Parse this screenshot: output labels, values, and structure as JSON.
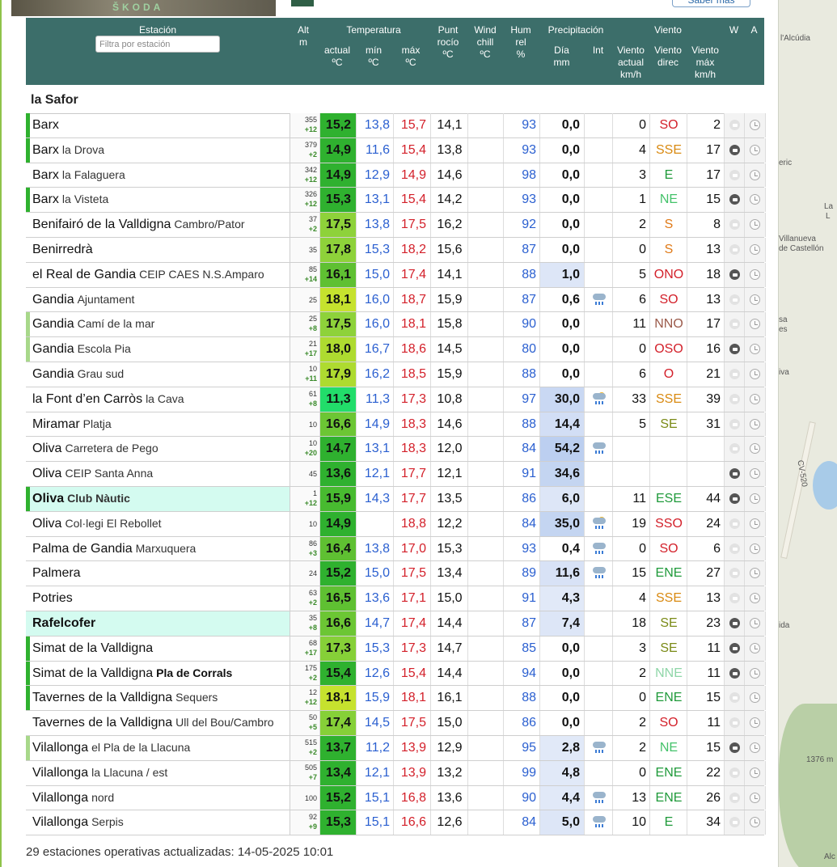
{
  "ad": {
    "brand": "ŠKODA",
    "button_label": "Saber más"
  },
  "header": {
    "station": "Estación",
    "filter_placeholder": "Filtra por estación",
    "alt": "Alt",
    "alt_unit": "m",
    "temperatura": "Temperatura",
    "actual": "actual",
    "actual_unit": "ºC",
    "min": "mín",
    "min_unit": "ºC",
    "max": "máx",
    "max_unit": "ºC",
    "dew_1": "Punt",
    "dew_2": "rocío",
    "dew_unit": "ºC",
    "wc_1": "Wind",
    "wc_2": "chill",
    "wc_unit": "ºC",
    "hum_1": "Hum",
    "hum_2": "rel",
    "hum_unit": "%",
    "precip": "Precipitación",
    "dia": "Día",
    "dia_unit": "mm",
    "int": "Int",
    "viento": "Viento",
    "wact_1": "Viento",
    "wact_2": "actual",
    "wact_unit": "km/h",
    "wdir_1": "Viento",
    "wdir_2": "direc",
    "wmax_1": "Viento",
    "wmax_2": "máx",
    "wmax_unit": "km/h",
    "w": "W",
    "a": "A"
  },
  "region": "la Safor",
  "stations": [
    {
      "name": "Barx",
      "sub": "",
      "alt": "355",
      "d": "+12",
      "t": "15,2",
      "tc": "#2fb12f",
      "min": "13,8",
      "max": "15,7",
      "dew": "14,1",
      "hum": "93",
      "p": "0,0",
      "pc": "",
      "int": "",
      "wa": "0",
      "wd": "SO",
      "wdc": "#d3202a",
      "wm": "2",
      "bar": "#2fb12f",
      "hl": false,
      "cam": "off"
    },
    {
      "name": "Barx",
      "sub": "la Drova",
      "alt": "379",
      "d": "+2",
      "t": "14,9",
      "tc": "#2fb12f",
      "min": "11,6",
      "max": "15,4",
      "dew": "13,8",
      "hum": "93",
      "p": "0,0",
      "pc": "",
      "int": "",
      "wa": "4",
      "wd": "SSE",
      "wdc": "#d98a12",
      "wm": "17",
      "bar": "#2fb12f",
      "hl": false,
      "cam": "on"
    },
    {
      "name": "Barx",
      "sub": "la Falaguera",
      "alt": "342",
      "d": "+12",
      "t": "14,9",
      "tc": "#2fb12f",
      "min": "12,9",
      "max": "14,9",
      "dew": "14,6",
      "hum": "98",
      "p": "0,0",
      "pc": "",
      "int": "",
      "wa": "3",
      "wd": "E",
      "wdc": "#1f9a3a",
      "wm": "17",
      "bar": "",
      "hl": false,
      "cam": "off"
    },
    {
      "name": "Barx",
      "sub": "la Visteta",
      "alt": "326",
      "d": "+12",
      "t": "15,3",
      "tc": "#2fb12f",
      "min": "13,1",
      "max": "15,4",
      "dew": "14,2",
      "hum": "93",
      "p": "0,0",
      "pc": "",
      "int": "",
      "wa": "1",
      "wd": "NE",
      "wdc": "#44c26a",
      "wm": "15",
      "bar": "#2fb12f",
      "hl": false,
      "cam": "on"
    },
    {
      "name": "Benifairó de la Valldigna",
      "sub": "Cambro/Pator",
      "alt": "37",
      "d": "+2",
      "t": "17,5",
      "tc": "#8ed23a",
      "min": "13,8",
      "max": "17,5",
      "dew": "16,2",
      "hum": "92",
      "p": "0,0",
      "pc": "",
      "int": "",
      "wa": "2",
      "wd": "S",
      "wdc": "#e07a18",
      "wm": "8",
      "bar": "",
      "hl": false,
      "cam": "off"
    },
    {
      "name": "Benirredrà",
      "sub": "",
      "alt": "35",
      "d": "",
      "t": "17,8",
      "tc": "#8ed23a",
      "min": "15,3",
      "max": "18,2",
      "dew": "15,6",
      "hum": "87",
      "p": "0,0",
      "pc": "",
      "int": "",
      "wa": "0",
      "wd": "S",
      "wdc": "#e07a18",
      "wm": "13",
      "bar": "",
      "hl": false,
      "cam": "off"
    },
    {
      "name": "el Real de Gandia",
      "sub": "CEIP CAES N.S.Amparo",
      "alt": "85",
      "d": "+14",
      "t": "16,1",
      "tc": "#5fc032",
      "min": "15,0",
      "max": "17,4",
      "dew": "14,1",
      "hum": "88",
      "p": "1,0",
      "pc": "#dde6f7",
      "int": "",
      "wa": "5",
      "wd": "ONO",
      "wdc": "#d3202a",
      "wm": "18",
      "bar": "",
      "hl": false,
      "cam": "on"
    },
    {
      "name": "Gandia",
      "sub": "Ajuntament",
      "alt": "25",
      "d": "",
      "t": "18,1",
      "tc": "#c6e22e",
      "min": "16,0",
      "max": "18,7",
      "dew": "15,9",
      "hum": "87",
      "p": "0,6",
      "pc": "",
      "int": "rain",
      "wa": "6",
      "wd": "SO",
      "wdc": "#d3202a",
      "wm": "13",
      "bar": "",
      "hl": false,
      "cam": "off"
    },
    {
      "name": "Gandia",
      "sub": "Camí de la mar",
      "alt": "25",
      "d": "+8",
      "t": "17,5",
      "tc": "#8ed23a",
      "min": "16,0",
      "max": "18,1",
      "dew": "15,8",
      "hum": "90",
      "p": "0,0",
      "pc": "",
      "int": "",
      "wa": "11",
      "wd": "NNO",
      "wdc": "#9b5a4a",
      "wm": "17",
      "bar": "#a8d88a",
      "hl": false,
      "cam": "off"
    },
    {
      "name": "Gandia",
      "sub": "Escola Pia",
      "alt": "21",
      "d": "+17",
      "t": "18,0",
      "tc": "#aedb30",
      "min": "16,7",
      "max": "18,6",
      "dew": "14,5",
      "hum": "80",
      "p": "0,0",
      "pc": "",
      "int": "",
      "wa": "0",
      "wd": "OSO",
      "wdc": "#d3202a",
      "wm": "16",
      "bar": "#a8d88a",
      "hl": false,
      "cam": "on"
    },
    {
      "name": "Gandia",
      "sub": "Grau sud",
      "alt": "10",
      "d": "+11",
      "t": "17,9",
      "tc": "#aedb30",
      "min": "16,2",
      "max": "18,5",
      "dew": "15,9",
      "hum": "88",
      "p": "0,0",
      "pc": "",
      "int": "",
      "wa": "6",
      "wd": "O",
      "wdc": "#d3202a",
      "wm": "21",
      "bar": "",
      "hl": false,
      "cam": "off"
    },
    {
      "name": "la Font d’en Carròs",
      "sub": "la Cava",
      "alt": "61",
      "d": "+8",
      "t": "11,3",
      "tc": "#22dd6a",
      "min": "11,3",
      "max": "17,3",
      "dew": "10,8",
      "hum": "97",
      "p": "30,0",
      "pc": "#c9d8f3",
      "int": "storm",
      "wa": "33",
      "wd": "SSE",
      "wdc": "#d98a12",
      "wm": "39",
      "bar": "",
      "hl": false,
      "cam": "off"
    },
    {
      "name": "Miramar",
      "sub": "Platja",
      "alt": "10",
      "d": "",
      "t": "16,6",
      "tc": "#6cc634",
      "min": "14,9",
      "max": "18,3",
      "dew": "14,6",
      "hum": "88",
      "p": "14,4",
      "pc": "#d2def5",
      "int": "",
      "wa": "5",
      "wd": "SE",
      "wdc": "#7a8a16",
      "wm": "31",
      "bar": "",
      "hl": false,
      "cam": "off"
    },
    {
      "name": "Oliva",
      "sub": "Carretera de Pego",
      "alt": "10",
      "d": "+20",
      "t": "14,7",
      "tc": "#2fb12f",
      "min": "13,1",
      "max": "18,3",
      "dew": "12,0",
      "hum": "84",
      "p": "54,2",
      "pc": "#bccff0",
      "int": "rain",
      "wa": "",
      "wd": "",
      "wdc": "#111",
      "wm": "",
      "bar": "",
      "hl": false,
      "cam": "off"
    },
    {
      "name": "Oliva",
      "sub": "CEIP Santa Anna",
      "alt": "45",
      "d": "",
      "t": "13,6",
      "tc": "#2fb12f",
      "min": "12,1",
      "max": "17,7",
      "dew": "12,1",
      "hum": "91",
      "p": "34,6",
      "pc": "#c4d5f1",
      "int": "",
      "wa": "",
      "wd": "",
      "wdc": "#111",
      "wm": "",
      "bar": "",
      "hl": false,
      "cam": "on"
    },
    {
      "name": "Oliva",
      "sub": "Club Nàutic",
      "alt": "1",
      "d": "+12",
      "t": "15,9",
      "tc": "#48bb30",
      "min": "14,3",
      "max": "17,7",
      "dew": "13,5",
      "hum": "86",
      "p": "6,0",
      "pc": "#dde6f7",
      "int": "",
      "wa": "11",
      "wd": "ESE",
      "wdc": "#1f9a3a",
      "wm": "44",
      "bar": "#2fb12f",
      "hl": true,
      "cam": "on"
    },
    {
      "name": "Oliva",
      "sub": "Col·legi El Rebollet",
      "alt": "10",
      "d": "",
      "t": "14,9",
      "tc": "#2fb12f",
      "min": "",
      "max": "18,8",
      "dew": "12,2",
      "hum": "84",
      "p": "35,0",
      "pc": "#c4d5f1",
      "int": "storm",
      "wa": "19",
      "wd": "SSO",
      "wdc": "#d3202a",
      "wm": "24",
      "bar": "",
      "hl": false,
      "cam": "off"
    },
    {
      "name": "Palma de Gandia",
      "sub": "Marxuquera",
      "alt": "86",
      "d": "+3",
      "t": "16,4",
      "tc": "#5fc032",
      "min": "13,8",
      "max": "17,0",
      "dew": "15,3",
      "hum": "93",
      "p": "0,4",
      "pc": "",
      "int": "rain",
      "wa": "0",
      "wd": "SO",
      "wdc": "#d3202a",
      "wm": "6",
      "bar": "",
      "hl": false,
      "cam": "off"
    },
    {
      "name": "Palmera",
      "sub": "",
      "alt": "24",
      "d": "",
      "t": "15,2",
      "tc": "#2fb12f",
      "min": "15,0",
      "max": "17,5",
      "dew": "13,4",
      "hum": "89",
      "p": "11,6",
      "pc": "#d8e2f6",
      "int": "rain",
      "wa": "15",
      "wd": "ENE",
      "wdc": "#1f9a3a",
      "wm": "27",
      "bar": "",
      "hl": false,
      "cam": "off"
    },
    {
      "name": "Potries",
      "sub": "",
      "alt": "63",
      "d": "+2",
      "t": "16,5",
      "tc": "#5fc032",
      "min": "13,6",
      "max": "17,1",
      "dew": "15,0",
      "hum": "91",
      "p": "4,3",
      "pc": "#e1e9f8",
      "int": "",
      "wa": "4",
      "wd": "SSE",
      "wdc": "#d98a12",
      "wm": "13",
      "bar": "",
      "hl": false,
      "cam": "off"
    },
    {
      "name": "Rafelcofer",
      "sub": "",
      "alt": "35",
      "d": "+8",
      "t": "16,6",
      "tc": "#6cc634",
      "min": "14,7",
      "max": "17,4",
      "dew": "14,4",
      "hum": "87",
      "p": "7,4",
      "pc": "#dde6f7",
      "int": "",
      "wa": "18",
      "wd": "SE",
      "wdc": "#7a8a16",
      "wm": "23",
      "bar": "",
      "hl": true,
      "cam": "on"
    },
    {
      "name": "Simat de la Valldigna",
      "sub": "",
      "alt": "68",
      "d": "+17",
      "t": "17,3",
      "tc": "#86d038",
      "min": "15,3",
      "max": "17,3",
      "dew": "14,7",
      "hum": "85",
      "p": "0,0",
      "pc": "",
      "int": "",
      "wa": "3",
      "wd": "SE",
      "wdc": "#7a8a16",
      "wm": "11",
      "bar": "#2fb12f",
      "hl": false,
      "cam": "on"
    },
    {
      "name": "Simat de la Valldigna",
      "sub": "Pla de Corrals",
      "subbold": true,
      "alt": "175",
      "d": "+2",
      "t": "15,4",
      "tc": "#2fb12f",
      "min": "12,6",
      "max": "15,4",
      "dew": "14,4",
      "hum": "94",
      "p": "0,0",
      "pc": "",
      "int": "",
      "wa": "2",
      "wd": "NNE",
      "wdc": "#8fd6a8",
      "wm": "11",
      "bar": "#2fb12f",
      "hl": false,
      "cam": "on"
    },
    {
      "name": "Tavernes de la Valldigna",
      "sub": "Sequers",
      "alt": "12",
      "d": "+12",
      "t": "18,1",
      "tc": "#c6e22e",
      "min": "15,9",
      "max": "18,1",
      "dew": "16,1",
      "hum": "88",
      "p": "0,0",
      "pc": "",
      "int": "",
      "wa": "0",
      "wd": "ENE",
      "wdc": "#1f9a3a",
      "wm": "15",
      "bar": "#2fb12f",
      "hl": false,
      "cam": "off"
    },
    {
      "name": "Tavernes de la Valldigna",
      "sub": "Ull del Bou/Cambro",
      "alt": "50",
      "d": "+5",
      "t": "17,4",
      "tc": "#86d038",
      "min": "14,5",
      "max": "17,5",
      "dew": "15,0",
      "hum": "86",
      "p": "0,0",
      "pc": "",
      "int": "",
      "wa": "2",
      "wd": "SO",
      "wdc": "#d3202a",
      "wm": "11",
      "bar": "",
      "hl": false,
      "cam": "off"
    },
    {
      "name": "Vilallonga",
      "sub": "el Pla de la Llacuna",
      "alt": "515",
      "d": "+2",
      "t": "13,7",
      "tc": "#2fb12f",
      "min": "11,2",
      "max": "13,9",
      "dew": "12,9",
      "hum": "95",
      "p": "2,8",
      "pc": "#e1e9f8",
      "int": "rain",
      "wa": "2",
      "wd": "NE",
      "wdc": "#44c26a",
      "wm": "15",
      "bar": "#a8d88a",
      "hl": false,
      "cam": "on"
    },
    {
      "name": "Vilallonga",
      "sub": "la Llacuna / est",
      "alt": "505",
      "d": "+7",
      "t": "13,4",
      "tc": "#2fb12f",
      "min": "12,1",
      "max": "13,9",
      "dew": "13,2",
      "hum": "99",
      "p": "4,8",
      "pc": "#e1e9f8",
      "int": "",
      "wa": "0",
      "wd": "ENE",
      "wdc": "#1f9a3a",
      "wm": "22",
      "bar": "",
      "hl": false,
      "cam": "off"
    },
    {
      "name": "Vilallonga",
      "sub": "nord",
      "alt": "100",
      "d": "",
      "t": "15,2",
      "tc": "#2fb12f",
      "min": "15,1",
      "max": "16,8",
      "dew": "13,6",
      "hum": "90",
      "p": "4,4",
      "pc": "#e1e9f8",
      "int": "rain",
      "wa": "13",
      "wd": "ENE",
      "wdc": "#1f9a3a",
      "wm": "26",
      "bar": "",
      "hl": false,
      "cam": "off"
    },
    {
      "name": "Vilallonga",
      "sub": "Serpis",
      "alt": "92",
      "d": "+9",
      "t": "15,3",
      "tc": "#2fb12f",
      "min": "15,1",
      "max": "16,6",
      "dew": "12,6",
      "hum": "84",
      "p": "5,0",
      "pc": "#dde6f7",
      "int": "rain",
      "wa": "10",
      "wd": "E",
      "wdc": "#1f9a3a",
      "wm": "34",
      "bar": "",
      "hl": false,
      "cam": "off"
    }
  ],
  "footer": "29 estaciones operativas actualizadas: 14-05-2025 10:01",
  "map_labels": [
    "l'Alcúdia",
    "eric",
    "La",
    "L",
    "Villanueva",
    "de Castellón",
    "sa",
    "es",
    "iva",
    "CV-520",
    "ida",
    "1376 m",
    "Alc"
  ]
}
